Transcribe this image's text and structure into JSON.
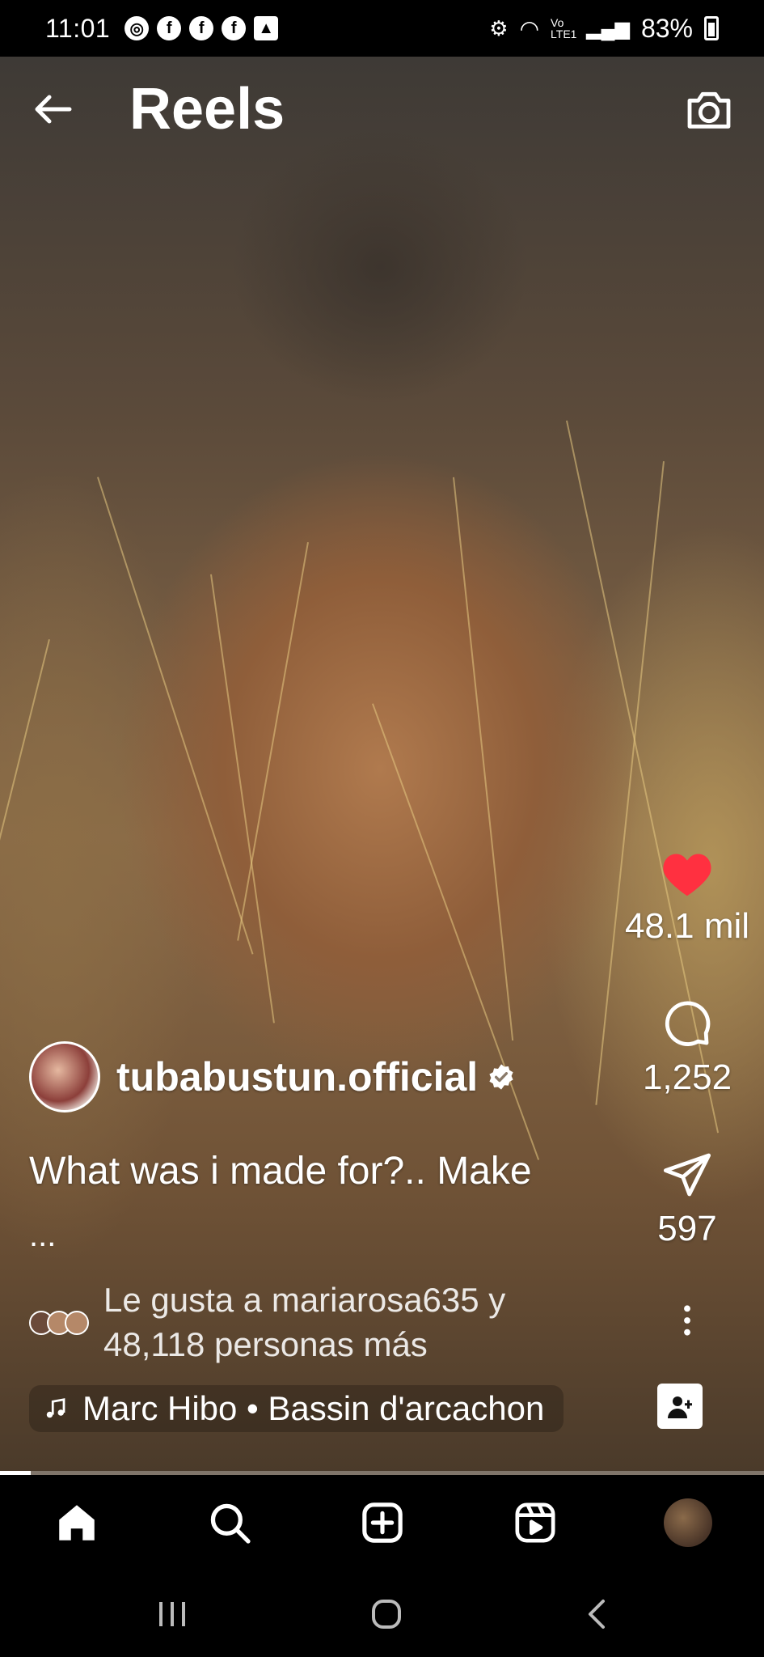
{
  "status_bar": {
    "time": "11:01",
    "network": "Vo LTE1",
    "battery": "83%"
  },
  "header": {
    "title": "Reels"
  },
  "actions": {
    "likes": "48.1 mil",
    "comments": "1,252",
    "shares": "597"
  },
  "post": {
    "username": "tubabustun.official",
    "caption": "What was i made for?.. Make",
    "caption_more": "...",
    "liked_by": "Le gusta a mariarosa635 y 48,118 personas más",
    "music": "Marc Hibo • Bassin d'arcachon"
  },
  "playback": {
    "progress": 0.04
  },
  "colors": {
    "like_active": "#ff3040",
    "background": "#000000",
    "text": "#ffffff"
  },
  "icons": [
    "back-arrow-icon",
    "camera-icon",
    "heart-icon",
    "comment-icon",
    "share-icon",
    "more-vertical-icon",
    "verified-icon",
    "music-note-icon",
    "home-icon",
    "search-icon",
    "create-icon",
    "reels-icon"
  ]
}
